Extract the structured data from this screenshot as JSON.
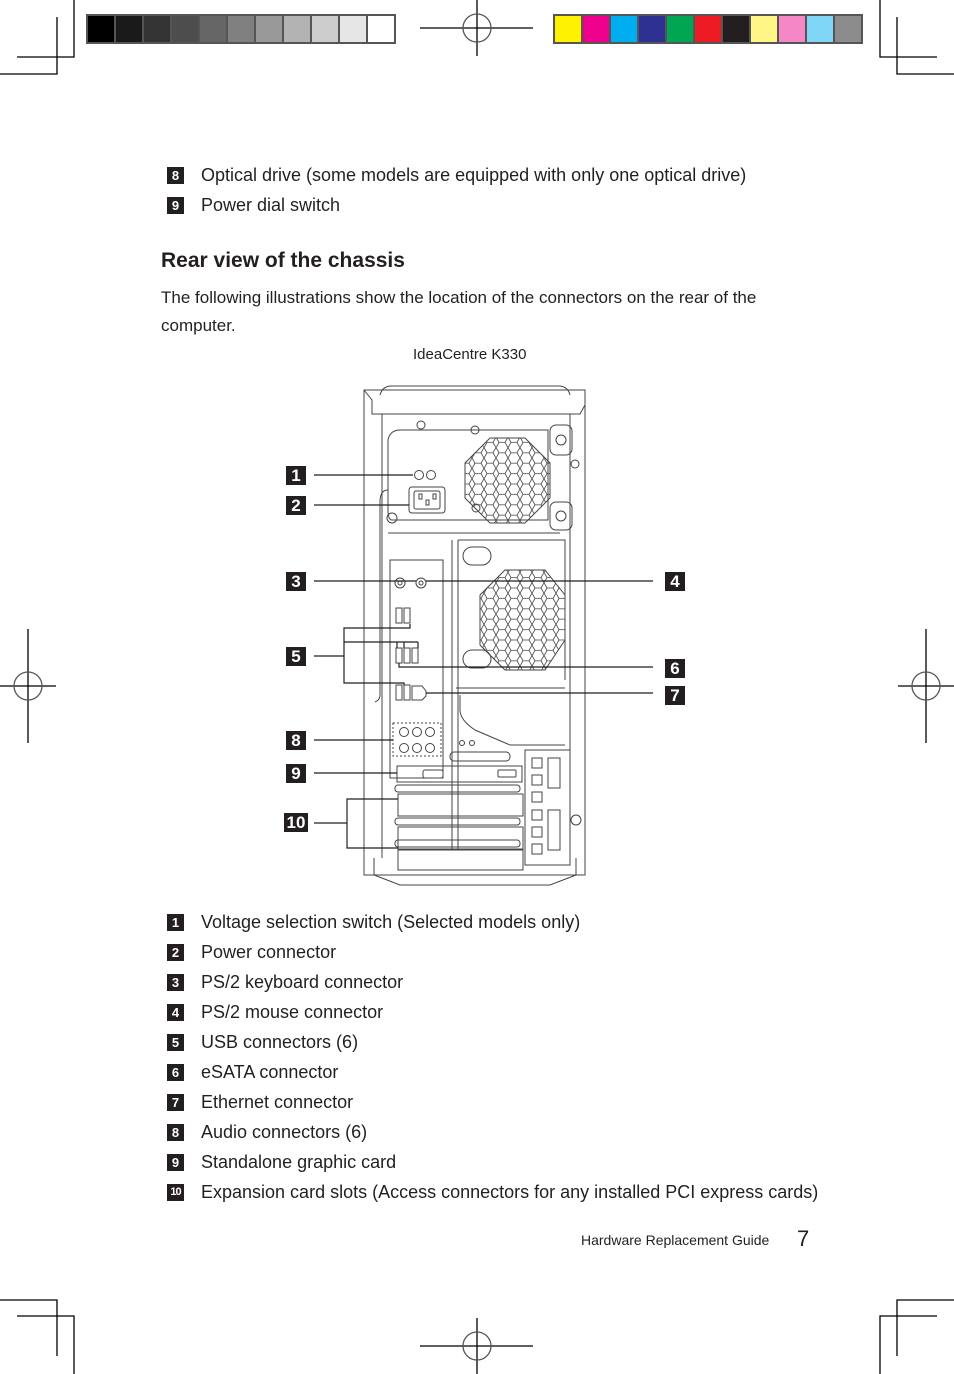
{
  "print_marks": {
    "grayscale_swatches": [
      "#000000",
      "#1a1a1a",
      "#333333",
      "#4d4d4d",
      "#666666",
      "#808080",
      "#999999",
      "#b3b3b3",
      "#cccccc",
      "#e6e6e6",
      "#ffffff"
    ],
    "color_swatches": [
      "#fff200",
      "#ec008c",
      "#00aeef",
      "#2e3192",
      "#00a651",
      "#ed1c24",
      "#231f20",
      "#fff685",
      "#f587c7",
      "#7fd6f7",
      "#8c8c8c"
    ]
  },
  "top_list": [
    {
      "number": "8",
      "text": "Optical drive (some models are equipped with only one optical drive)"
    },
    {
      "number": "9",
      "text": "Power dial switch"
    }
  ],
  "section": {
    "heading": "Rear view of the chassis",
    "paragraph": "The following illustrations show the location of the connectors on the rear of the computer."
  },
  "figure": {
    "caption": "IdeaCentre K330",
    "callouts": [
      "1",
      "2",
      "3",
      "4",
      "5",
      "6",
      "7",
      "8",
      "9",
      "10"
    ]
  },
  "legend": [
    {
      "number": "1",
      "text": "Voltage selection switch (Selected models only)"
    },
    {
      "number": "2",
      "text": "Power connector"
    },
    {
      "number": "3",
      "text": "PS/2 keyboard connector"
    },
    {
      "number": "4",
      "text": "PS/2 mouse connector"
    },
    {
      "number": "5",
      "text": "USB connectors (6)"
    },
    {
      "number": "6",
      "text": "eSATA connector"
    },
    {
      "number": "7",
      "text": "Ethernet connector"
    },
    {
      "number": "8",
      "text": "Audio connectors (6)"
    },
    {
      "number": "9",
      "text": "Standalone graphic card"
    },
    {
      "number": "10",
      "text": "Expansion card slots (Access connectors for any installed PCI express cards)"
    }
  ],
  "footer": {
    "title": "Hardware Replacement Guide",
    "page_number": "7"
  }
}
